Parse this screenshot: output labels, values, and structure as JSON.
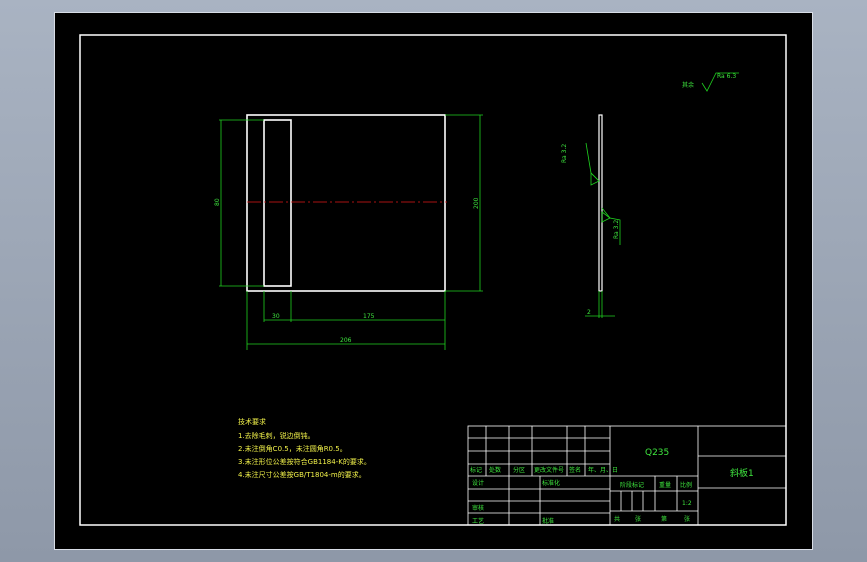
{
  "drawing": {
    "roughness_label": "其余",
    "roughness_value": "Ra 6.3",
    "dim_height_left": "80",
    "dim_height_right": "200",
    "dim_width_a": "30",
    "dim_width_b": "175",
    "dim_width_total": "206",
    "side_roughness_1": "Ra 3.2",
    "side_roughness_2": "Ra 3.2",
    "dim_thickness": "2"
  },
  "tech_requirements": {
    "title": "技术要求",
    "lines": [
      "1.去除毛刺，锐边倒钝。",
      "2.未注倒角C0.5，未注圆角R0.5。",
      "3.未注形位公差按符合GB1184-K的要求。",
      "4.未注尺寸公差按GB/T1804-m的要求。"
    ]
  },
  "title_block": {
    "material": "Q235",
    "part_name": "斜板1",
    "header_cells": [
      "标记",
      "处数",
      "分区",
      "更改文件号",
      "签名",
      "年、月、日"
    ],
    "design": "设计",
    "standardization": "标准化",
    "review": "审核",
    "process": "工艺",
    "approve": "批准",
    "stage_mark": "阶段标记",
    "weight": "重量",
    "scale": "比例",
    "scale_value": "1:2",
    "sheet_labels": [
      "共",
      "张",
      "第",
      "张"
    ]
  },
  "colors": {
    "background": "#000000",
    "outline": "#ffffff",
    "dimension": "#1fd11f",
    "centerline": "#e01818",
    "note_text": "#f2f24a"
  }
}
